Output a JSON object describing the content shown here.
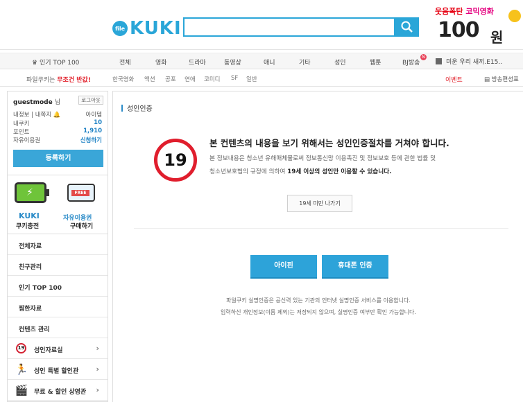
{
  "header": {
    "logo_file": "file",
    "logo_text": "KUKI",
    "search_value": "",
    "promo_line1_red": "웃음",
    "promo_line1_mid": "폭탄",
    "promo_line1_pink": "코믹영화",
    "promo_price": "100",
    "promo_won": "원"
  },
  "nav": {
    "top100": "인기 TOP 100",
    "items": [
      "전체",
      "영화",
      "드라마",
      "동영상",
      "애니",
      "기타",
      "성인",
      "웹툰",
      "BJ방송"
    ],
    "badge": "N",
    "news": "미운 우리 새끼.E15.."
  },
  "subnav": {
    "promo_prefix": "파일쿠키는",
    "promo_bold": "무조건 반값!",
    "items": [
      "한국영화",
      "액션",
      "공포",
      "연애",
      "코미디",
      "SF",
      "일반"
    ],
    "event": "이벤트",
    "broadcast": "방송편성표"
  },
  "sidebar": {
    "username": "guestmode",
    "sir": "님",
    "logout": "로그아웃",
    "mypage": "내정보 | 내쪽지",
    "item_label": "아이템",
    "cookie_label": "내쿠키",
    "cookie_value": "10",
    "point_label": "포인트",
    "point_value": "1,910",
    "pass_label": "자유이용권",
    "pass_value": "신청하기",
    "register": "등록하기",
    "charge_title": "KUKI",
    "charge_sub": "쿠키충전",
    "free_card": "FREE",
    "pass_title": "자유이용권",
    "pass_sub": "구매하기",
    "menu": [
      {
        "label": "전체자료"
      },
      {
        "label": "친구관리"
      },
      {
        "label": "인기 TOP 100"
      },
      {
        "label": "찜한자료"
      },
      {
        "label": "컨텐츠 관리"
      },
      {
        "label": "성인자료실",
        "badge": "19"
      },
      {
        "label": "성인 특별 할인관"
      },
      {
        "label": "무료 & 할인 상영관"
      }
    ]
  },
  "main": {
    "title": "성인인증",
    "age": "19",
    "head_prefix": "본 컨텐츠의 내용을 보기 위해서는 ",
    "head_bold": "성인인증절차",
    "head_suffix": "를 거쳐야 합니다.",
    "body_1": "본 정보내용은 청소년 유해매체물로써 정보통신망 이용촉진 및 정보보호 등에 관한 법률 및",
    "body_2": "청소년보호법의 규정에 의하여 ",
    "body_bold": "19세 이상의 성인만 이용할 수 있습니다.",
    "under19": "19세 미만 나가기",
    "ipin": "아이핀",
    "phone": "휴대폰 인증",
    "foot1": "파일쿠키 실명인증은 공신력 있는 기관의 인터넷 실명인증 서비스를 이용합니다.",
    "foot2": "입력하신 개인정보(이름 제외)는 저장되지 않으며, 실명인증 여부만 확인 가능합니다."
  }
}
